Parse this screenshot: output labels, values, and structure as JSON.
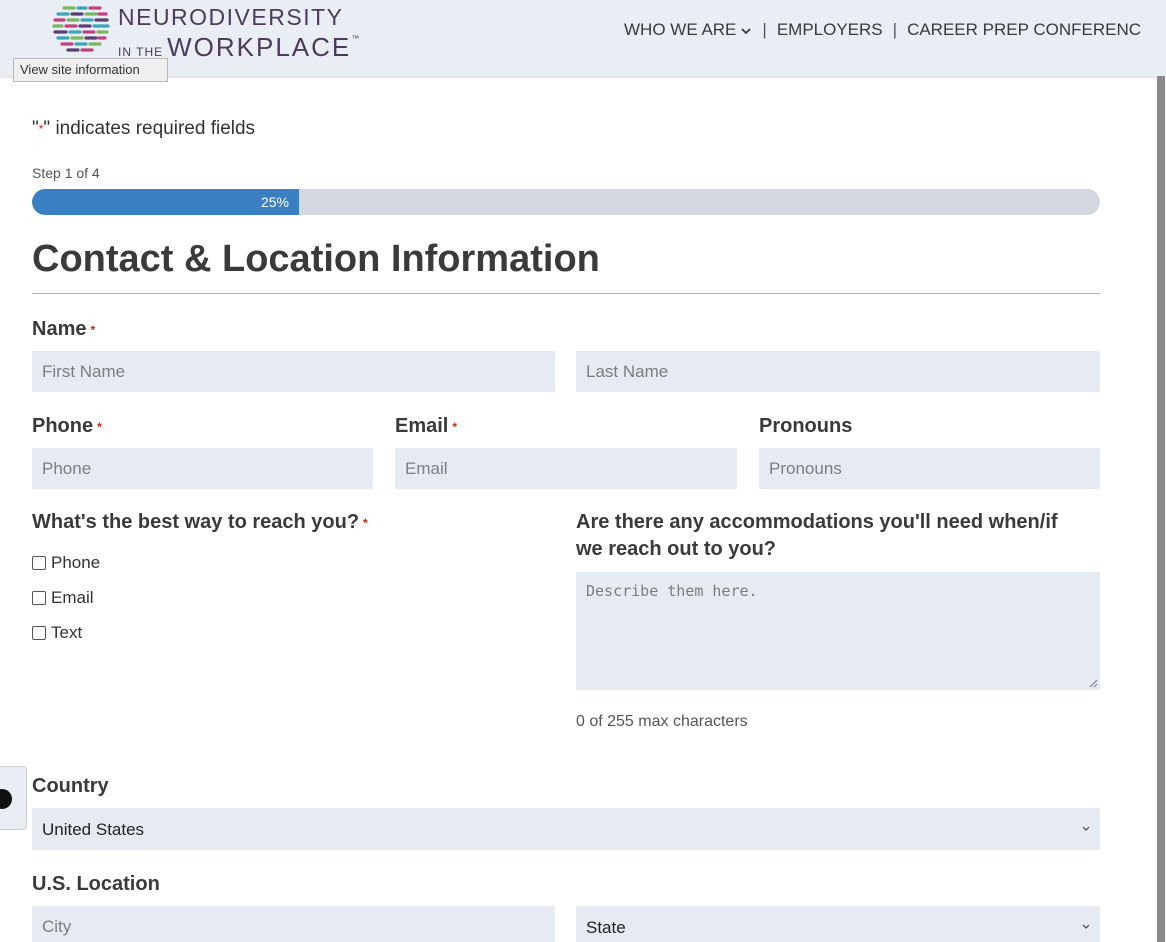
{
  "header": {
    "logo_line1": "NEURODIVERSITY",
    "logo_inthe": "IN THE",
    "logo_workplace": "WORKPLACE",
    "logo_tm": "™",
    "tooltip": "View site information",
    "nav": [
      {
        "label": "WHO WE ARE",
        "has_dropdown": true
      },
      {
        "label": "EMPLOYERS",
        "has_dropdown": false
      },
      {
        "label": "CAREER PREP CONFERENC",
        "has_dropdown": false
      }
    ],
    "nav_separator": "|"
  },
  "form": {
    "required_note_prefix": "\"",
    "required_star": "*",
    "required_note_suffix": "\" indicates required fields",
    "step_text": "Step 1 of 4",
    "progress": {
      "percent": 25,
      "label": "25%"
    },
    "title": "Contact & Location Information",
    "name_label": "Name",
    "first_name_placeholder": "First Name",
    "last_name_placeholder": "Last Name",
    "phone_label": "Phone",
    "phone_placeholder": "Phone",
    "email_label": "Email",
    "email_placeholder": "Email",
    "pronouns_label": "Pronouns",
    "pronouns_placeholder": "Pronouns",
    "reach_label": "What's the best way to reach you?",
    "reach_options": [
      "Phone",
      "Email",
      "Text"
    ],
    "accommodations_label_line1": "Are there any accommodations you'll need when/if",
    "accommodations_label_line2": "we reach out to you?",
    "accommodations_placeholder": "Describe them here.",
    "char_count": "0 of 255 max characters",
    "country_label": "Country",
    "country_value": "United States",
    "location_label": "U.S. Location",
    "city_placeholder": "City",
    "state_value": "State"
  },
  "colors": {
    "accent": "#3a7fc1",
    "required": "#c02b0a",
    "field_bg": "#e6ebf3",
    "header_bg": "#e9edf4"
  }
}
